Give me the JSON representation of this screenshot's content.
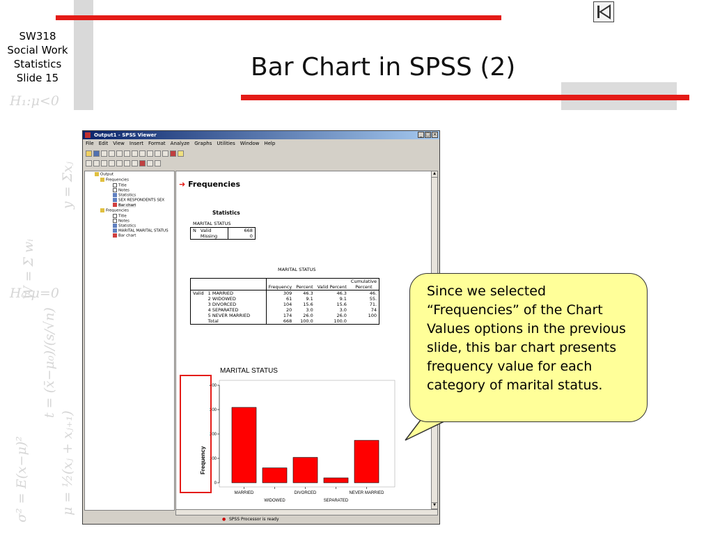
{
  "slide": {
    "sidebar_lines": [
      "SW318",
      "Social Work",
      "Statistics",
      "Slide 15"
    ],
    "title": "Bar Chart in SPSS (2)",
    "nav_icon": "first-slide-icon",
    "math": [
      "H₁:μ<0",
      "σ² = E(x−μ)²",
      "y = Σxⱼ",
      "W = Σ wᵢ",
      "H₀:μ=0",
      "t = (x̄−μ₀)/(s/√n)",
      "μ = ½(xⱼ + xⱼ₊₁)"
    ]
  },
  "window": {
    "title": "Output1 - SPSS Viewer",
    "menu": [
      "File",
      "Edit",
      "View",
      "Insert",
      "Format",
      "Analyze",
      "Graphs",
      "Utilities",
      "Window",
      "Help"
    ],
    "status": "SPSS Processor  is ready",
    "tree": [
      {
        "label": "Output",
        "icon": "book-icon"
      },
      {
        "label": "Frequencies",
        "icon": "book-icon"
      },
      {
        "label": "Title",
        "icon": "page-icon"
      },
      {
        "label": "Notes",
        "icon": "page-icon"
      },
      {
        "label": "Statistics",
        "icon": "table-icon"
      },
      {
        "label": "SEX  RESPONDENTS SEX",
        "icon": "table-icon"
      },
      {
        "label": "Bar chart",
        "icon": "chart-icon"
      },
      {
        "label": "Frequencies",
        "icon": "book-icon"
      },
      {
        "label": "Title",
        "icon": "page-icon"
      },
      {
        "label": "Notes",
        "icon": "page-icon"
      },
      {
        "label": "Statistics",
        "icon": "table-icon"
      },
      {
        "label": "MARITAL  MARITAL STATUS",
        "icon": "table-icon"
      },
      {
        "label": "Bar chart",
        "icon": "chart-icon"
      }
    ]
  },
  "output": {
    "heading": "Frequencies",
    "stats_title": "Statistics",
    "stats_var": "MARITAL STATUS",
    "stats_rows": [
      {
        "a": "N",
        "b": "Valid",
        "c": "668"
      },
      {
        "a": "",
        "b": "Missing",
        "c": "0"
      }
    ],
    "freq_title": "MARITAL STATUS",
    "freq_headers": [
      "Frequency",
      "Percent",
      "Valid Percent",
      "Cumulative Percent"
    ],
    "freq_rows": [
      {
        "lead": "Valid",
        "cat": "1  MARRIED",
        "f": "309",
        "p": "46.3",
        "vp": "46.3",
        "cp": "46."
      },
      {
        "lead": "",
        "cat": "2  WIDOWED",
        "f": "61",
        "p": "9.1",
        "vp": "9.1",
        "cp": "55."
      },
      {
        "lead": "",
        "cat": "3  DIVORCED",
        "f": "104",
        "p": "15.6",
        "vp": "15.6",
        "cp": "71."
      },
      {
        "lead": "",
        "cat": "4  SEPARATED",
        "f": "20",
        "p": "3.0",
        "vp": "3.0",
        "cp": "74"
      },
      {
        "lead": "",
        "cat": "5  NEVER MARRIED",
        "f": "174",
        "p": "26.0",
        "vp": "26.0",
        "cp": "100"
      },
      {
        "lead": "",
        "cat": "Total",
        "f": "668",
        "p": "100.0",
        "vp": "100.0",
        "cp": ""
      }
    ]
  },
  "callout": {
    "text": "Since we selected “Frequencies” of the Chart Values options in the previous slide, this bar chart presents frequency value for each category of marital status."
  },
  "chart_data": {
    "type": "bar",
    "title": "MARITAL STATUS",
    "categories": [
      "MARRIED",
      "WIDOWED",
      "DIVORCED",
      "SEPARATED",
      "NEVER MARRIED"
    ],
    "values": [
      309,
      61,
      104,
      20,
      174
    ],
    "ylabel": "Frequency",
    "xlabel": "",
    "ylim": [
      0,
      400
    ],
    "yticks": [
      0,
      100,
      200,
      300,
      400
    ],
    "bar_color": "#ff0000",
    "highlight_color": "#e41b17",
    "grid": false
  }
}
